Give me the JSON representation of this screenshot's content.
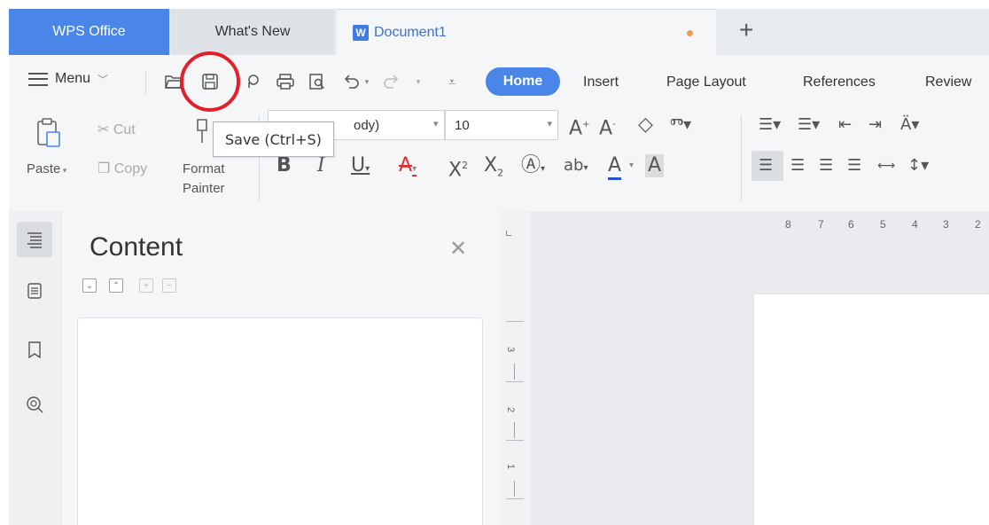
{
  "tabs": {
    "wps": "WPS Office",
    "whats_new": "What's New",
    "document": "Document1",
    "document_icon": "W",
    "add": "+"
  },
  "quickbar": {
    "menu_label": "Menu",
    "tooltip": "Save (Ctrl+S)"
  },
  "ribbon_tabs": {
    "home": "Home",
    "insert": "Insert",
    "page_layout": "Page Layout",
    "references": "References",
    "review": "Review"
  },
  "clipboard": {
    "cut": "Cut",
    "copy": "Copy",
    "paste": "Paste",
    "format": "Format",
    "painter": "Painter"
  },
  "font": {
    "name_partial": "ody)",
    "size": "10"
  },
  "navigation": {
    "title": "Content"
  },
  "ruler": {
    "horizontal": [
      "8",
      "7",
      "6",
      "5",
      "4",
      "3",
      "2"
    ],
    "vertical": [
      "3",
      "2",
      "1"
    ],
    "corner": "L"
  },
  "colors": {
    "accent": "#4a86e8",
    "highlight_circle": "#e3202a",
    "modified_dot": "#e99a55"
  }
}
